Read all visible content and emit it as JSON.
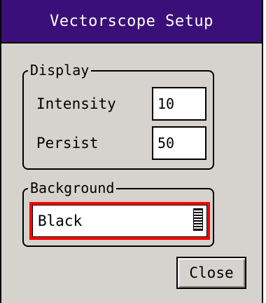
{
  "dialog": {
    "title": "Vectorscope Setup"
  },
  "display_group": {
    "legend": "Display",
    "intensity_label": "Intensity",
    "intensity_value": "10",
    "persist_label": "Persist",
    "persist_value": "50"
  },
  "background_group": {
    "legend": "Background",
    "selected": "Black"
  },
  "buttons": {
    "close_label": "Close"
  },
  "colors": {
    "titlebar": "#3b0f7a",
    "dialog_bg": "#d6d2ce",
    "focus_ring": "#ff0000"
  }
}
